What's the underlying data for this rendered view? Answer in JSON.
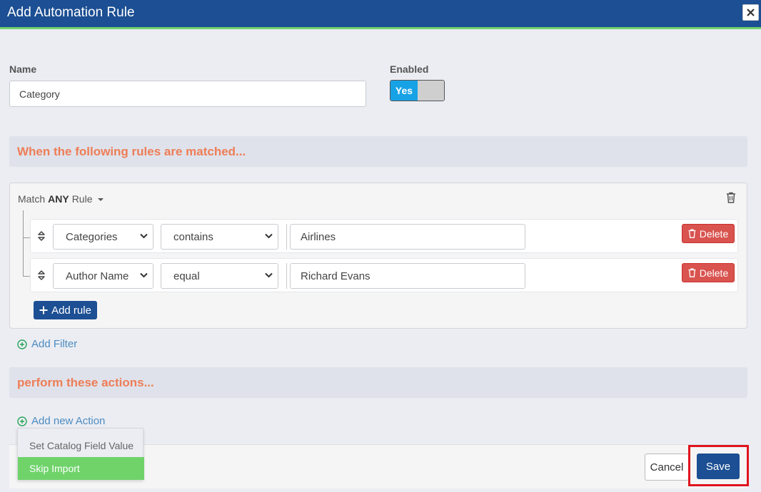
{
  "dialog": {
    "title": "Add Automation Rule"
  },
  "form": {
    "name_label": "Name",
    "name_value": "Category",
    "enabled_label": "Enabled",
    "enabled_toggle_label": "Yes",
    "enabled": true
  },
  "conditions": {
    "header": "When the following rules are matched...",
    "match_prefix": "Match",
    "match_mode": "ANY",
    "match_suffix": "Rule",
    "rules": [
      {
        "field": "Categories",
        "operator": "contains",
        "value": "Airlines",
        "delete_label": "Delete"
      },
      {
        "field": "Author Name",
        "operator": "equal",
        "value": "Richard Evans",
        "delete_label": "Delete"
      }
    ],
    "add_rule_label": "Add rule",
    "add_filter_label": "Add Filter"
  },
  "actions": {
    "header": "perform these actions...",
    "add_action_label": "Add new Action",
    "menu_items": [
      "Set Catalog Field Value",
      "Skip Import"
    ],
    "menu_highlighted_index": 1
  },
  "footer": {
    "cancel_label": "Cancel",
    "save_label": "Save"
  },
  "colors": {
    "titlebar": "#1c4f93",
    "accent_green": "#6fd36a",
    "section_text": "#ee7d57",
    "toggle_on": "#17a2e6",
    "delete_red": "#d9534f",
    "highlight_box": "#e0141e"
  }
}
